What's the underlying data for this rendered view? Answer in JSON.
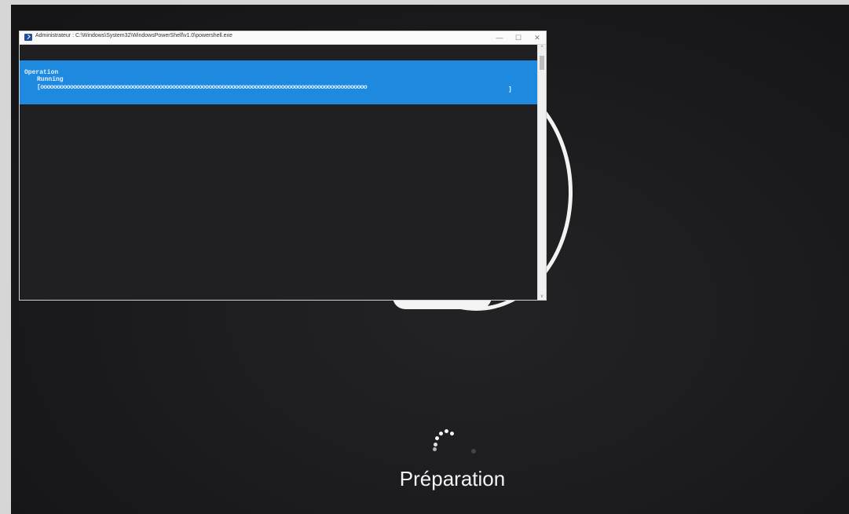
{
  "powershell_window": {
    "title": "Administrateur : C:\\Windows\\System32\\WindowsPowerShell\\v1.0\\powershell.exe",
    "controls": {
      "minimize": "—",
      "maximize": "☐",
      "close": "✕"
    },
    "progress": {
      "operation_label": "Operation",
      "status_label": "Running",
      "bar_text": "[ooooooooooooooooooooooooooooooooooooooooooooooooooooooooooooooooooooooooooooooooooooooooooooooooooo",
      "bar_close": "]"
    },
    "scroll": {
      "up": "^",
      "down": "v"
    }
  },
  "setup_screen": {
    "status_text": "Préparation"
  },
  "colors": {
    "progress_background": "#1d8ae0",
    "screen_background": "#1b1b1d",
    "ring_color": "#f2f2f2"
  }
}
